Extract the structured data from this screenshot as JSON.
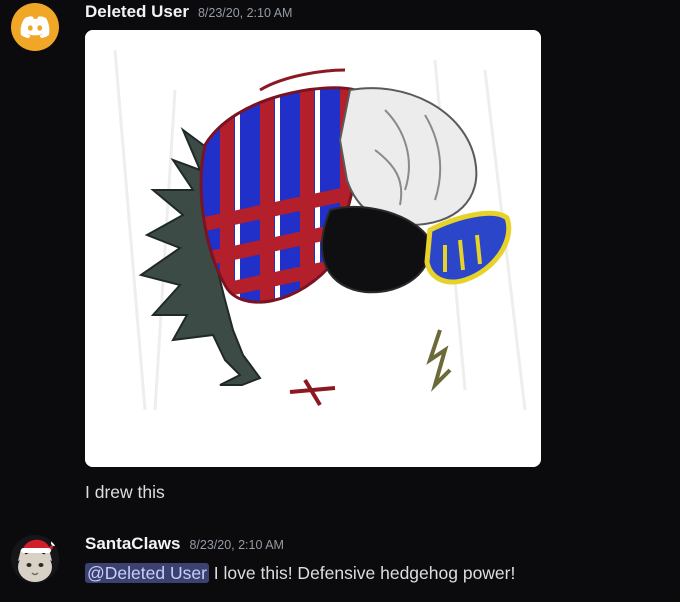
{
  "messages": [
    {
      "username": "Deleted User",
      "timestamp": "8/23/20, 2:10 AM",
      "avatar": {
        "icon": "discord-logo-icon",
        "color": "#f0a627"
      },
      "attachment": {
        "kind": "image",
        "subject": "hedgehog-drawing"
      },
      "text": "I drew this"
    },
    {
      "username": "SantaClaws",
      "timestamp": "8/23/20, 2:10 AM",
      "avatar": {
        "icon": "cat-santa-hat-icon"
      },
      "mention": "@Deleted User",
      "text": "I love this! Defensive hedgehog power!"
    }
  ],
  "colors": {
    "background": "#0b0b0d",
    "username": "#f2f3f5",
    "timestamp": "#949ba4",
    "text": "#dbdee1",
    "mention_bg": "#3c4270",
    "mention_fg": "#c9cdfb"
  }
}
